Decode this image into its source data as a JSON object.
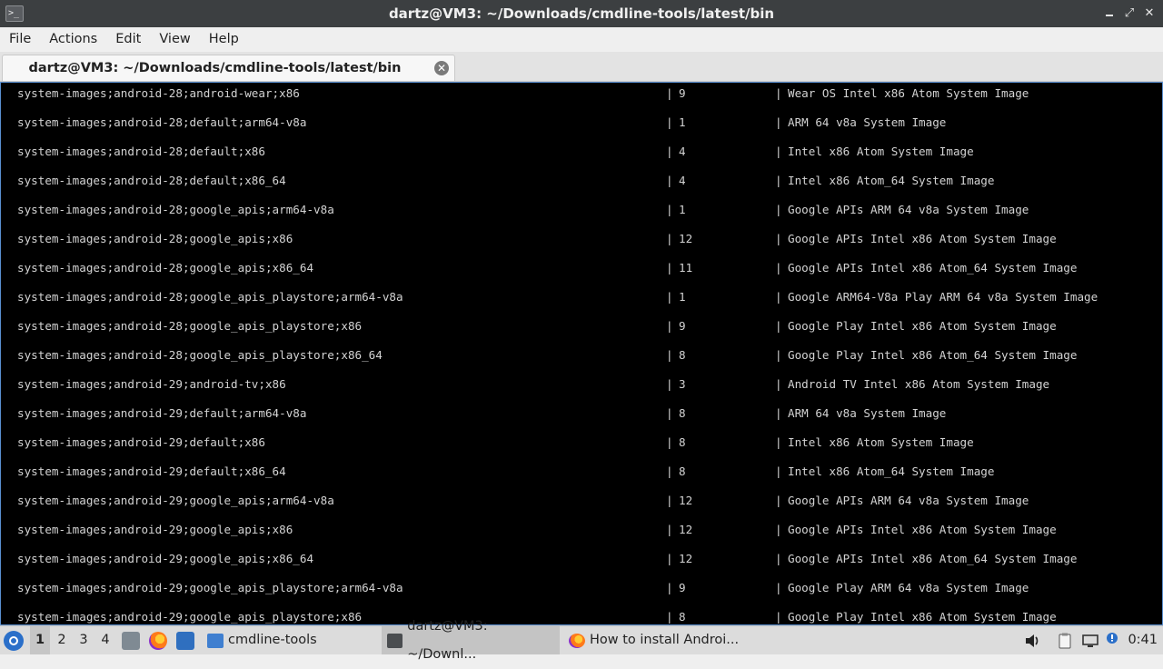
{
  "window": {
    "title": "dartz@VM3: ~/Downloads/cmdline-tools/latest/bin",
    "app_icon": "terminal-icon",
    "buttons": {
      "minimize": "–",
      "maximize": "⤢",
      "close": "✕"
    }
  },
  "menu": {
    "items": [
      "File",
      "Actions",
      "Edit",
      "View",
      "Help"
    ]
  },
  "tabs": [
    {
      "label": "dartz@VM3: ~/Downloads/cmdline-tools/latest/bin",
      "close_icon": "close-circle-icon"
    }
  ],
  "terminal": {
    "separator": "|",
    "rows": [
      {
        "path": "system-images;android-28;android-wear;x86",
        "version": "9",
        "description": "Wear OS Intel x86 Atom System Image"
      },
      {
        "path": "system-images;android-28;default;arm64-v8a",
        "version": "1",
        "description": "ARM 64 v8a System Image"
      },
      {
        "path": "system-images;android-28;default;x86",
        "version": "4",
        "description": "Intel x86 Atom System Image"
      },
      {
        "path": "system-images;android-28;default;x86_64",
        "version": "4",
        "description": "Intel x86 Atom_64 System Image"
      },
      {
        "path": "system-images;android-28;google_apis;arm64-v8a",
        "version": "1",
        "description": "Google APIs ARM 64 v8a System Image"
      },
      {
        "path": "system-images;android-28;google_apis;x86",
        "version": "12",
        "description": "Google APIs Intel x86 Atom System Image"
      },
      {
        "path": "system-images;android-28;google_apis;x86_64",
        "version": "11",
        "description": "Google APIs Intel x86 Atom_64 System Image"
      },
      {
        "path": "system-images;android-28;google_apis_playstore;arm64-v8a",
        "version": "1",
        "description": "Google ARM64-V8a Play ARM 64 v8a System Image"
      },
      {
        "path": "system-images;android-28;google_apis_playstore;x86",
        "version": "9",
        "description": "Google Play Intel x86 Atom System Image"
      },
      {
        "path": "system-images;android-28;google_apis_playstore;x86_64",
        "version": "8",
        "description": "Google Play Intel x86 Atom_64 System Image"
      },
      {
        "path": "system-images;android-29;android-tv;x86",
        "version": "3",
        "description": "Android TV Intel x86 Atom System Image"
      },
      {
        "path": "system-images;android-29;default;arm64-v8a",
        "version": "8",
        "description": "ARM 64 v8a System Image"
      },
      {
        "path": "system-images;android-29;default;x86",
        "version": "8",
        "description": "Intel x86 Atom System Image"
      },
      {
        "path": "system-images;android-29;default;x86_64",
        "version": "8",
        "description": "Intel x86 Atom_64 System Image"
      },
      {
        "path": "system-images;android-29;google_apis;arm64-v8a",
        "version": "12",
        "description": "Google APIs ARM 64 v8a System Image"
      },
      {
        "path": "system-images;android-29;google_apis;x86",
        "version": "12",
        "description": "Google APIs Intel x86 Atom System Image"
      },
      {
        "path": "system-images;android-29;google_apis;x86_64",
        "version": "12",
        "description": "Google APIs Intel x86 Atom_64 System Image"
      },
      {
        "path": "system-images;android-29;google_apis_playstore;arm64-v8a",
        "version": "9",
        "description": "Google Play ARM 64 v8a System Image"
      },
      {
        "path": "system-images;android-29;google_apis_playstore;x86",
        "version": "8",
        "description": "Google Play Intel x86 Atom System Image"
      }
    ]
  },
  "taskbar": {
    "start_icon": "start-menu-icon",
    "workspaces": [
      "1",
      "2",
      "3",
      "4"
    ],
    "active_workspace": "1",
    "quick_launch": [
      "file-manager-icon",
      "firefox-icon",
      "show-desktop-icon"
    ],
    "tasks": [
      {
        "label": "cmdline-tools",
        "icon": "folder-icon"
      },
      {
        "label": "dartz@VM3: ~/Downl...",
        "icon": "terminal-icon",
        "active": true
      },
      {
        "label": "How to install Androi...",
        "icon": "firefox-icon"
      }
    ],
    "tray": [
      "volume-icon",
      "clipboard-icon",
      "network-icon",
      "notification-icon"
    ],
    "clock": "0:41"
  },
  "colors": {
    "terminal_bg": "#000000",
    "terminal_fg": "#d3d3d3",
    "titlebar_bg": "#3c3f41",
    "accent": "#2a6fc9"
  }
}
